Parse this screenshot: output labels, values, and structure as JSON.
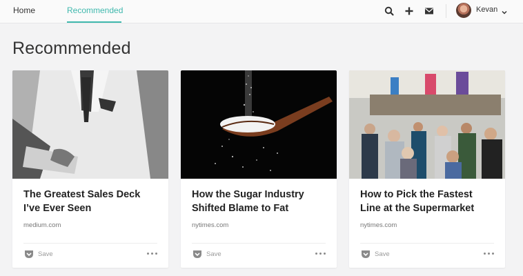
{
  "nav": {
    "home_label": "Home",
    "recommended_label": "Recommended",
    "accent_color": "#3fb8ad",
    "user_name": "Kevan",
    "icons": [
      "search-icon",
      "plus-icon",
      "mail-icon",
      "chevron-down-icon"
    ]
  },
  "page": {
    "title": "Recommended"
  },
  "cards": [
    {
      "title_line1": "The Greatest Sales Deck",
      "title_line2": "I’ve Ever Seen",
      "domain": "medium.com",
      "save_label": "Save",
      "image": "man-in-white-suit-with-laptop"
    },
    {
      "title_line1": "How the Sugar Industry",
      "title_line2": "Shifted Blame to Fat",
      "domain": "nytimes.com",
      "save_label": "Save",
      "image": "spoon-pouring-sugar"
    },
    {
      "title_line1": "How to Pick the Fastest",
      "title_line2": "Line at the Supermarket",
      "domain": "nytimes.com",
      "save_label": "Save",
      "image": "crowded-supermarket-lines"
    }
  ]
}
